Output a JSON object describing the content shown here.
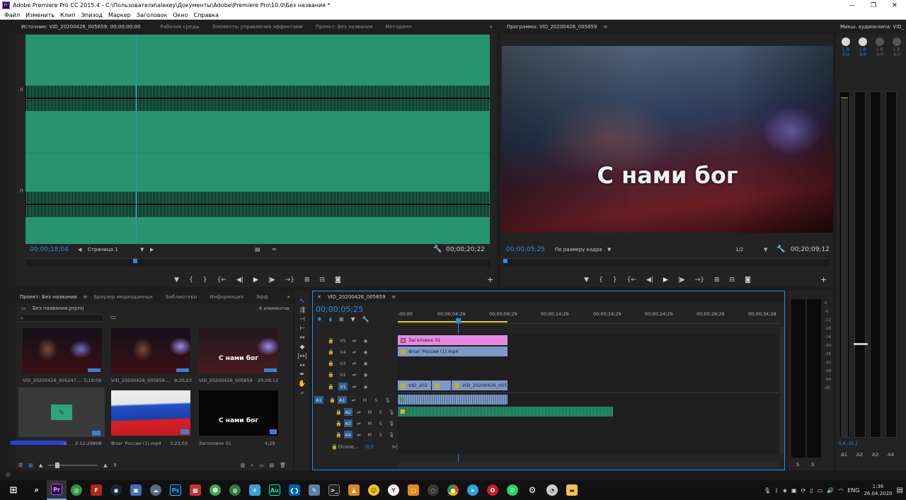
{
  "window": {
    "title": "Adobe Premiere Pro CC 2015.4 - C:\\Пользователи\\alexey\\Документы\\Adobe\\Premiere Pro\\10.0\\Без названия *",
    "logo": "Pr"
  },
  "menu": [
    "Файл",
    "Изменить",
    "Клип",
    "Эпизод",
    "Маркер",
    "Заголовок",
    "Окно",
    "Справка"
  ],
  "source_panel": {
    "tabs": [
      "Источник: VID_20200426_005659: 00;00;00;00",
      "Рабочие среды",
      "Элементы управления эффектами",
      "Проект: Без названия",
      "Метаданн"
    ],
    "channel_label_top": "Л",
    "channel_label_bottom": "П",
    "timecode_left": "00;00;18;04",
    "page_select": "Страница 1",
    "timecode_right": "00;00;20;22"
  },
  "program_panel": {
    "tab": "Программа: VID_20200426_005659",
    "overlay_text": "С нами бог",
    "timecode_left": "00;00;05;25",
    "fit_select": "По размеру кадра",
    "resolution": "1/2",
    "timecode_right": "00;20;09;12"
  },
  "audio_mixer": {
    "tab": "Микш. аудиоклипа: VID_",
    "channels": [
      {
        "lr": "L R",
        "value": "0,0",
        "name": "A1"
      },
      {
        "lr": "L R",
        "value": "0,0",
        "name": "A2"
      },
      {
        "lr": "L R",
        "value": "0,0",
        "name": "A3"
      },
      {
        "lr": "L R",
        "value": "0,0",
        "name": "A4"
      }
    ],
    "bottom_values": "5,6  -35,1",
    "level_a1": 0.98,
    "level_a2": 0.6
  },
  "project_panel": {
    "tabs": [
      "Проект: Без названия",
      "Браузер медиаданных",
      "Библиотеки",
      "Информация",
      "Эфф"
    ],
    "filename": "Без названия.prproj",
    "count": "6 элементов",
    "items": [
      {
        "name": "VID_20200426_005247....",
        "dur": "3;19;09",
        "kind": "video"
      },
      {
        "name": "VID_20200426_005659....",
        "dur": "9;20;23",
        "kind": "video"
      },
      {
        "name": "VID_20200426_005659",
        "dur": "20;09;12",
        "kind": "title",
        "text": "С нами бог"
      },
      {
        "name": "...е...",
        "dur": "2:12:29808",
        "kind": "audio"
      },
      {
        "name": "Флаг России (1).mp4",
        "dur": "3;23;03",
        "kind": "flag"
      },
      {
        "name": "Заголовок 01",
        "dur": "4;29",
        "kind": "black",
        "text": "С нами бог"
      }
    ]
  },
  "timeline": {
    "tab": "VID_20200426_005659",
    "timecode": "00;00;05;25",
    "ruler": [
      ":00;00",
      "00;00;04;29",
      "00;00;09;29",
      "00;00;14;29",
      "00;00;19;29",
      "00;00;24;29",
      "00;00;29;29",
      "00;00;34;28"
    ],
    "tracks_video": [
      "V5",
      "V4",
      "V3",
      "V2",
      "V1"
    ],
    "tracks_audio": [
      "A1",
      "A2",
      "A3",
      "A4"
    ],
    "source_patch": "A1",
    "master_label": "Основ...",
    "master_value": "0,0",
    "clips": {
      "v5": "Заголовок 01",
      "v4": "Флаг России (1).mp4",
      "v1a": "VID_202",
      "v1b": "VID_20200426_005"
    }
  },
  "meter": {
    "scale": [
      "0",
      "-6",
      "-12",
      "-18",
      "-24",
      "-30",
      "-36",
      "-42",
      "-48",
      "-54",
      "dB"
    ],
    "solo": [
      "S",
      "S"
    ]
  },
  "tray": {
    "lang": "ENG",
    "time": "1:36",
    "date": "26.04.2020"
  },
  "colors": {
    "waveform_bg": "#27946f",
    "clip_title": "#e58ae3",
    "clip_video": "#7d99c9",
    "clip_audio": "#2fa37a",
    "accent_blue": "#2d8ceb"
  }
}
